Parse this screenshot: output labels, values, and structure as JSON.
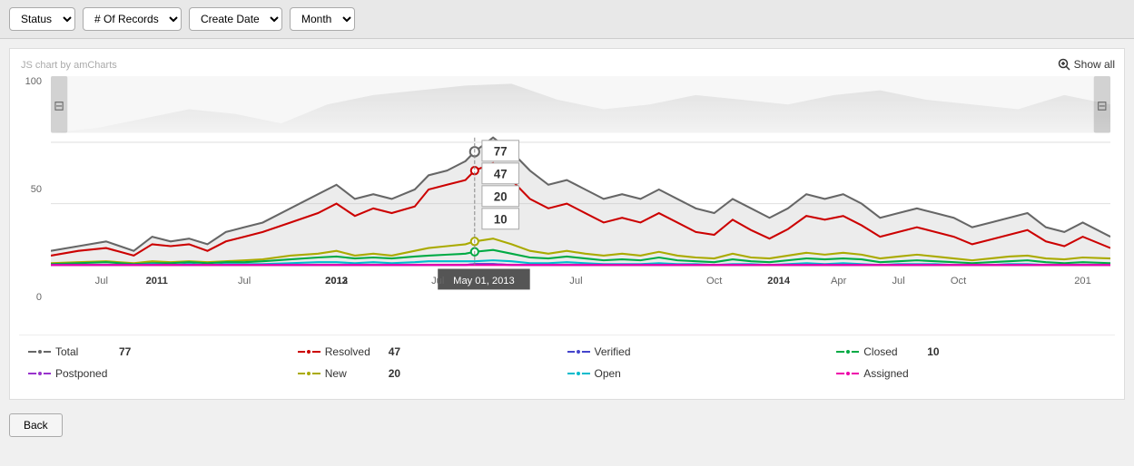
{
  "toolbar": {
    "status_label": "Status",
    "records_label": "# Of Records",
    "create_date_label": "Create Date",
    "month_label": "Month",
    "status_options": [
      "Status"
    ],
    "records_options": [
      "# Of Records"
    ],
    "date_options": [
      "Create Date"
    ],
    "period_options": [
      "Month"
    ]
  },
  "chart": {
    "watermark": "JS chart by amCharts",
    "show_all_label": "Show all",
    "y_labels": [
      "100",
      "50",
      "0"
    ],
    "x_labels": [
      {
        "text": "Jul",
        "pct": 5,
        "bold": false
      },
      {
        "text": "2011",
        "pct": 10,
        "bold": true
      },
      {
        "text": "Jul",
        "pct": 18,
        "bold": false
      },
      {
        "text": "2012",
        "pct": 27,
        "bold": true
      },
      {
        "text": "Jul",
        "pct": 37,
        "bold": false
      },
      {
        "text": "2013",
        "pct": 47,
        "bold": true
      },
      {
        "text": "Jul",
        "pct": 57,
        "bold": false
      },
      {
        "text": "Oct",
        "pct": 63,
        "bold": false
      },
      {
        "text": "2014",
        "pct": 68,
        "bold": true
      },
      {
        "text": "Apr",
        "pct": 74,
        "bold": false
      },
      {
        "text": "Jul",
        "pct": 80,
        "bold": false
      },
      {
        "text": "Oct",
        "pct": 86,
        "bold": false
      },
      {
        "text": "201",
        "pct": 95,
        "bold": false
      }
    ],
    "tooltip": {
      "date": "May 01, 2013",
      "values": [
        {
          "label": "77"
        },
        {
          "label": "47"
        },
        {
          "label": "20"
        },
        {
          "label": "10"
        }
      ]
    }
  },
  "legend": {
    "items": [
      {
        "id": "total",
        "label": "Total",
        "value": "77",
        "color": "#666666"
      },
      {
        "id": "resolved",
        "label": "Resolved",
        "value": "47",
        "color": "#cc0000"
      },
      {
        "id": "verified",
        "label": "Verified",
        "value": "",
        "color": "#4444cc"
      },
      {
        "id": "closed",
        "label": "Closed",
        "value": "10",
        "color": "#00aa44"
      },
      {
        "id": "postponed",
        "label": "Postponed",
        "value": "",
        "color": "#9933cc"
      },
      {
        "id": "new",
        "label": "New",
        "value": "20",
        "color": "#aaaa00"
      },
      {
        "id": "open",
        "label": "Open",
        "value": "",
        "color": "#00bbcc"
      },
      {
        "id": "assigned",
        "label": "Assigned",
        "value": "",
        "color": "#ee00aa"
      }
    ]
  },
  "back_button": "Back"
}
